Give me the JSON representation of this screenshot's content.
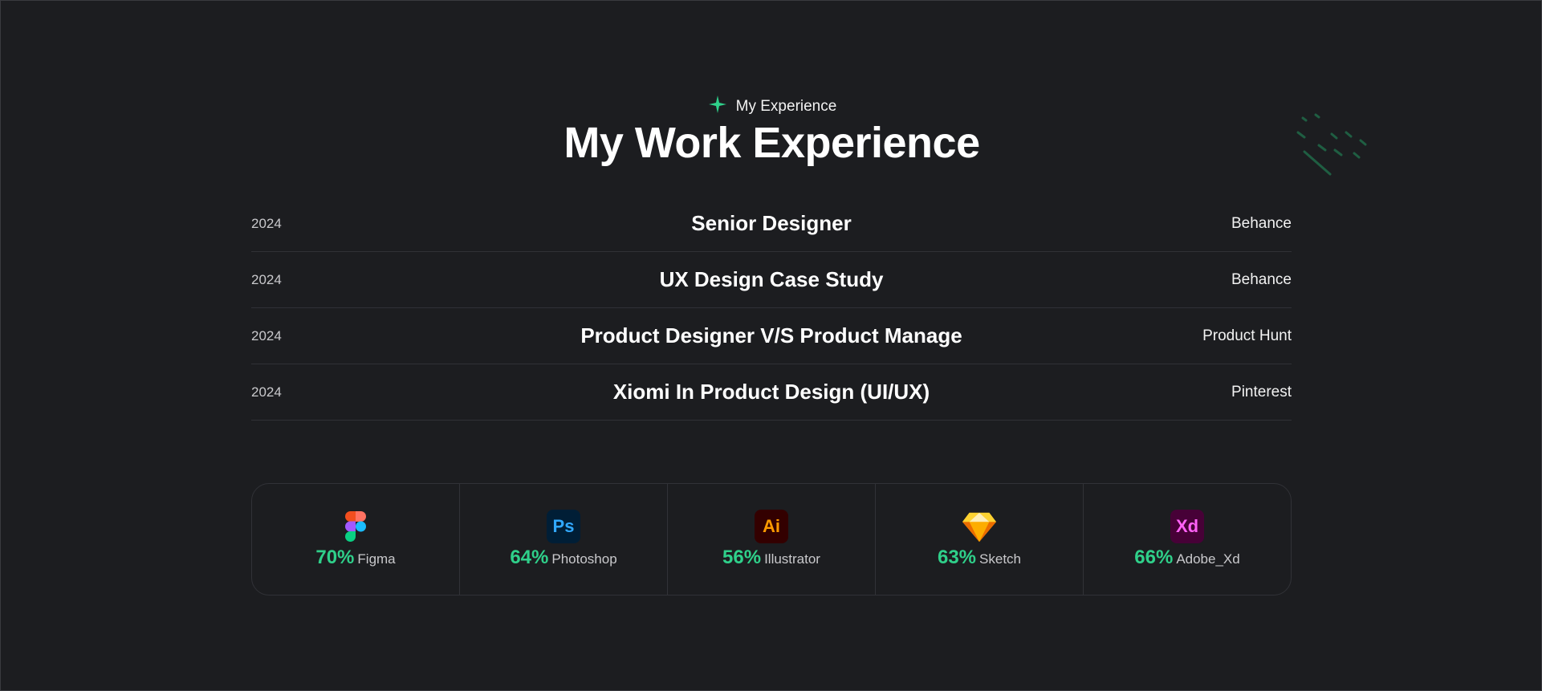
{
  "header": {
    "eyebrow": "My Experience",
    "title": "My Work Experience",
    "eyebrow_icon": "sparkle-icon",
    "accent": "#2fd08a"
  },
  "experience": [
    {
      "year": "2024",
      "title": "Senior Designer",
      "company": "Behance"
    },
    {
      "year": "2024",
      "title": "UX Design Case Study",
      "company": "Behance"
    },
    {
      "year": "2024",
      "title": "Product Designer V/S Product Manage",
      "company": "Product Hunt"
    },
    {
      "year": "2024",
      "title": "Xiomi In Product Design (UI/UX)",
      "company": "Pinterest"
    }
  ],
  "skills": [
    {
      "percent": "70%",
      "name": "Figma",
      "icon": "figma-icon"
    },
    {
      "percent": "64%",
      "name": "Photoshop",
      "icon": "photoshop-icon",
      "tile_text": "Ps",
      "tile_bg": "#001e36",
      "tile_fg": "#31a8ff"
    },
    {
      "percent": "56%",
      "name": "Illustrator",
      "icon": "illustrator-icon",
      "tile_text": "Ai",
      "tile_bg": "#330000",
      "tile_fg": "#ff9a00"
    },
    {
      "percent": "63%",
      "name": "Sketch",
      "icon": "sketch-icon"
    },
    {
      "percent": "66%",
      "name": "Adobe_Xd",
      "icon": "adobe-xd-icon",
      "tile_text": "Xd",
      "tile_bg": "#470137",
      "tile_fg": "#ff61f6"
    }
  ]
}
